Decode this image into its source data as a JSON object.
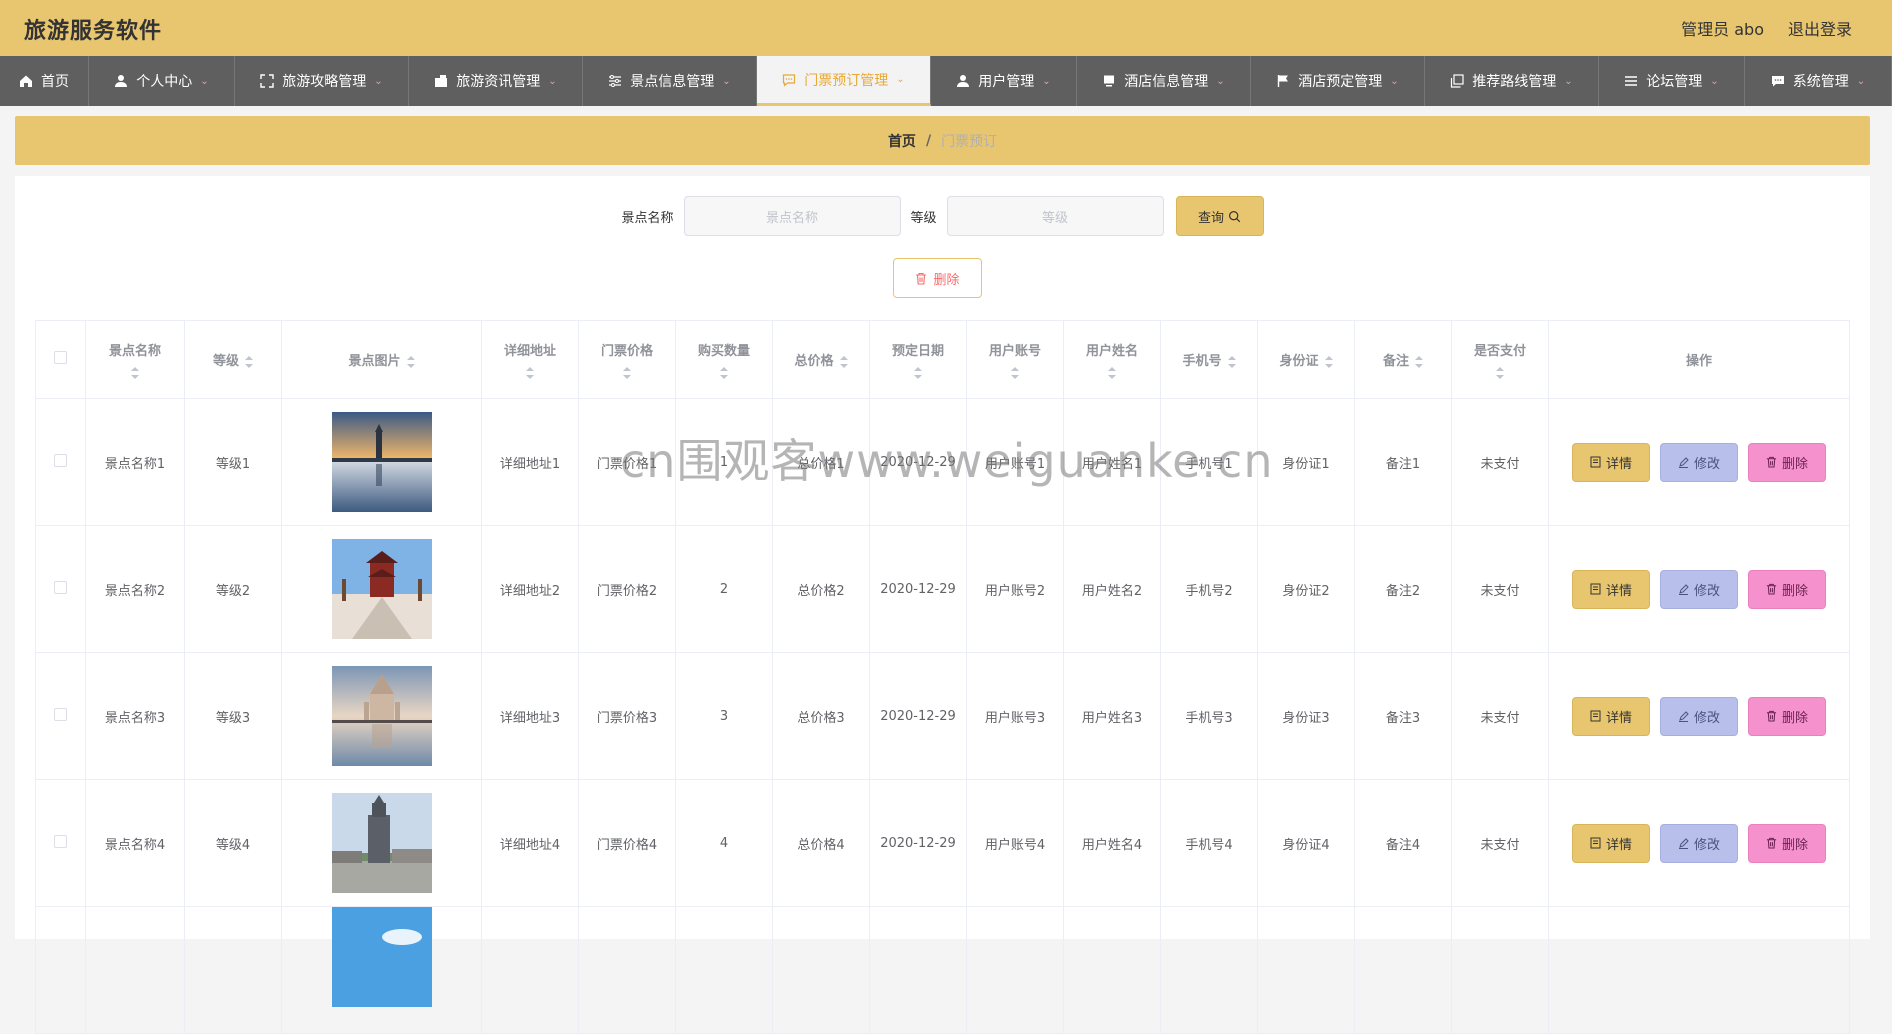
{
  "header": {
    "title": "旅游服务软件",
    "user_label": "管理员 abo",
    "logout_label": "退出登录"
  },
  "nav": [
    {
      "label": "首页",
      "icon": "home-icon",
      "chevron": false,
      "width": 89
    },
    {
      "label": "个人中心",
      "icon": "user-icon",
      "chevron": true,
      "width": 146
    },
    {
      "label": "旅游攻略管理",
      "icon": "fullscreen-icon",
      "chevron": true,
      "width": 174
    },
    {
      "label": "旅游资讯管理",
      "icon": "wallet-icon",
      "chevron": true,
      "width": 174
    },
    {
      "label": "景点信息管理",
      "icon": "sliders-icon",
      "chevron": true,
      "width": 174
    },
    {
      "label": "门票预订管理",
      "icon": "chat-icon",
      "chevron": true,
      "width": 174,
      "active": true
    },
    {
      "label": "用户管理",
      "icon": "user-icon",
      "chevron": true,
      "width": 146
    },
    {
      "label": "酒店信息管理",
      "icon": "monitor-icon",
      "chevron": true,
      "width": 174
    },
    {
      "label": "酒店预定管理",
      "icon": "flag-icon",
      "chevron": true,
      "width": 174
    },
    {
      "label": "推荐路线管理",
      "icon": "copy-icon",
      "chevron": true,
      "width": 174
    },
    {
      "label": "论坛管理",
      "icon": "list-icon",
      "chevron": true,
      "width": 146
    },
    {
      "label": "系统管理",
      "icon": "message-icon",
      "chevron": true,
      "width": 147
    }
  ],
  "breadcrumb": {
    "home": "首页",
    "separator": "/",
    "current": "门票预订"
  },
  "search": {
    "name_label": "景点名称",
    "name_placeholder": "景点名称",
    "level_label": "等级",
    "level_placeholder": "等级",
    "query_label": "查询"
  },
  "delete_label": "删除",
  "table": {
    "columns": [
      {
        "label": "景点名称",
        "stacked": true
      },
      {
        "label": "等级",
        "stacked": false
      },
      {
        "label": "景点图片",
        "stacked": false
      },
      {
        "label": "详细地址",
        "stacked": true
      },
      {
        "label": "门票价格",
        "stacked": true
      },
      {
        "label": "购买数量",
        "stacked": true
      },
      {
        "label": "总价格",
        "stacked": false
      },
      {
        "label": "预定日期",
        "stacked": true
      },
      {
        "label": "用户账号",
        "stacked": true
      },
      {
        "label": "用户姓名",
        "stacked": true
      },
      {
        "label": "手机号",
        "stacked": false
      },
      {
        "label": "身份证",
        "stacked": false
      },
      {
        "label": "备注",
        "stacked": false
      },
      {
        "label": "是否支付",
        "stacked": true
      },
      {
        "label": "操作",
        "stacked": false,
        "sortable": false
      }
    ],
    "rows": [
      {
        "name": "景点名称1",
        "level": "等级1",
        "image": "pagoda-lake",
        "address": "详细地址1",
        "price": "门票价格1",
        "qty": "1",
        "total": "总价格1",
        "date": "2020-12-29",
        "account": "用户账号1",
        "username": "用户姓名1",
        "phone": "手机号1",
        "idcard": "身份证1",
        "note": "备注1",
        "paid": "未支付"
      },
      {
        "name": "景点名称2",
        "level": "等级2",
        "image": "temple-courtyard",
        "address": "详细地址2",
        "price": "门票价格2",
        "qty": "2",
        "total": "总价格2",
        "date": "2020-12-29",
        "account": "用户账号2",
        "username": "用户姓名2",
        "phone": "手机号2",
        "idcard": "身份证2",
        "note": "备注2",
        "paid": "未支付"
      },
      {
        "name": "景点名称3",
        "level": "等级3",
        "image": "cathedral-reflection",
        "address": "详细地址3",
        "price": "门票价格3",
        "qty": "3",
        "total": "总价格3",
        "date": "2020-12-29",
        "account": "用户账号3",
        "username": "用户姓名3",
        "phone": "手机号3",
        "idcard": "身份证3",
        "note": "备注3",
        "paid": "未支付"
      },
      {
        "name": "景点名称4",
        "level": "等级4",
        "image": "monument-city",
        "address": "详细地址4",
        "price": "门票价格4",
        "qty": "4",
        "total": "总价格4",
        "date": "2020-12-29",
        "account": "用户账号4",
        "username": "用户姓名4",
        "phone": "手机号4",
        "idcard": "身份证4",
        "note": "备注4",
        "paid": "未支付"
      },
      {
        "name": "",
        "level": "",
        "image": "sky",
        "address": "",
        "price": "",
        "qty": "",
        "total": "",
        "date": "",
        "account": "",
        "username": "",
        "phone": "",
        "idcard": "",
        "note": "",
        "paid": ""
      }
    ],
    "actions": {
      "detail": "详情",
      "edit": "修改",
      "remove": "删除"
    }
  },
  "watermark": "cn围观客www.weiguanke.cn",
  "colors": {
    "accent": "#e8c56f",
    "nav_bg": "#5f5f5f",
    "edit": "#b7bfea",
    "remove": "#f592cd",
    "danger_text": "#f56c6c"
  }
}
